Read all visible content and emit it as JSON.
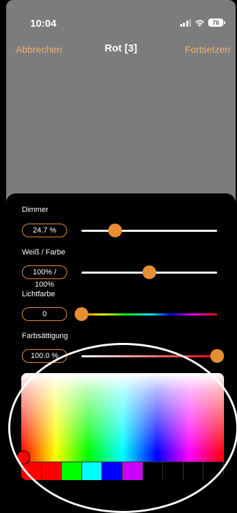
{
  "status_bar": {
    "time": "10:04",
    "battery": "76"
  },
  "navbar": {
    "cancel": "Abbrechen",
    "title": "Rot [3]",
    "continue": "Fortsetzen"
  },
  "controls": {
    "dimmer": {
      "label": "Dimmer",
      "value": "24.7 %",
      "level": 0.247
    },
    "white_color": {
      "label": "Weiß / Farbe",
      "value": "100% / 100%",
      "level": 0.5
    },
    "light_color": {
      "label": "Lichtfarbe",
      "value": "0",
      "level": 0.0
    },
    "saturation": {
      "label": "Farbsättigung",
      "value": "100.0 %",
      "level": 1.0
    }
  },
  "colors": {
    "accent": "#e58e32",
    "nav_link": "#f0b36f",
    "swatches": [
      "#ff0000",
      "#ff0000",
      "#00ff00",
      "#00ffff",
      "#0000ff",
      "#cc00ff",
      "#000000",
      "#000000",
      "#000000",
      "#000000"
    ]
  }
}
